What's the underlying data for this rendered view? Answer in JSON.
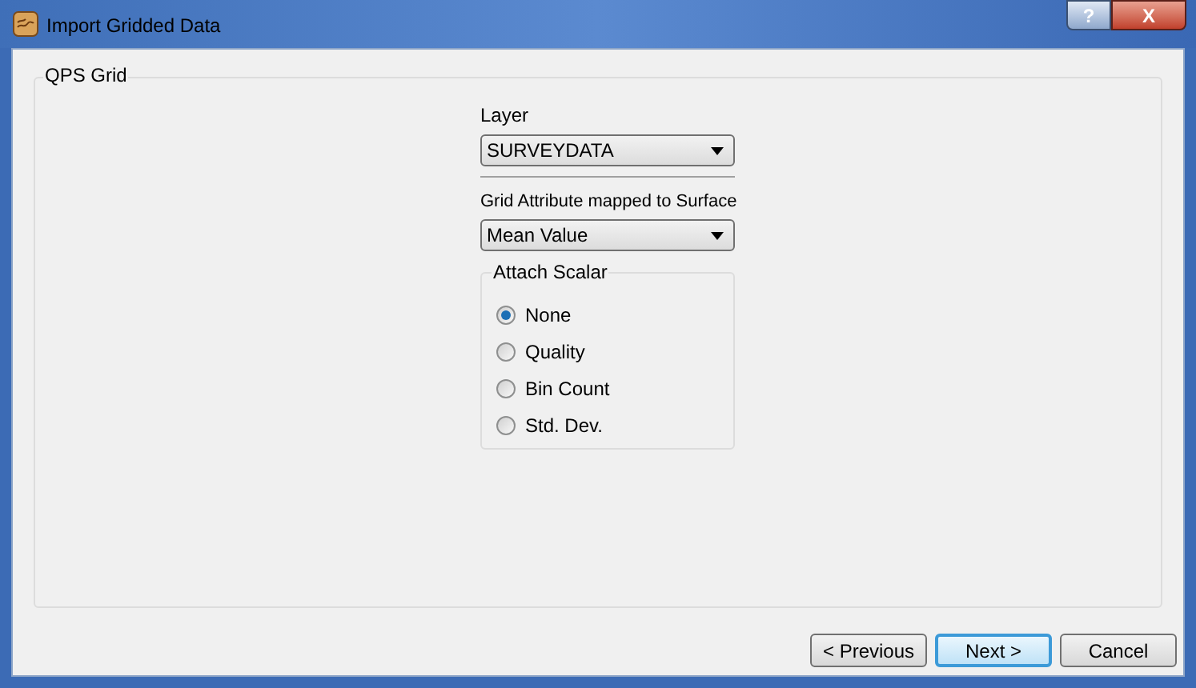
{
  "window": {
    "title": "Import Gridded Data",
    "help_button": "?",
    "close_button": "X"
  },
  "group": {
    "title": "QPS Grid"
  },
  "layer": {
    "label": "Layer",
    "value": "SURVEYDATA"
  },
  "attribute": {
    "label": "Grid Attribute mapped to Surface",
    "value": "Mean Value"
  },
  "scalar": {
    "title": "Attach Scalar",
    "options": [
      {
        "label": "None",
        "selected": true
      },
      {
        "label": "Quality",
        "selected": false
      },
      {
        "label": "Bin Count",
        "selected": false
      },
      {
        "label": "Std. Dev.",
        "selected": false
      }
    ]
  },
  "buttons": [
    {
      "label": "< Previous",
      "default": false
    },
    {
      "label": "Next >",
      "default": true
    },
    {
      "label": "Cancel",
      "default": false
    }
  ]
}
